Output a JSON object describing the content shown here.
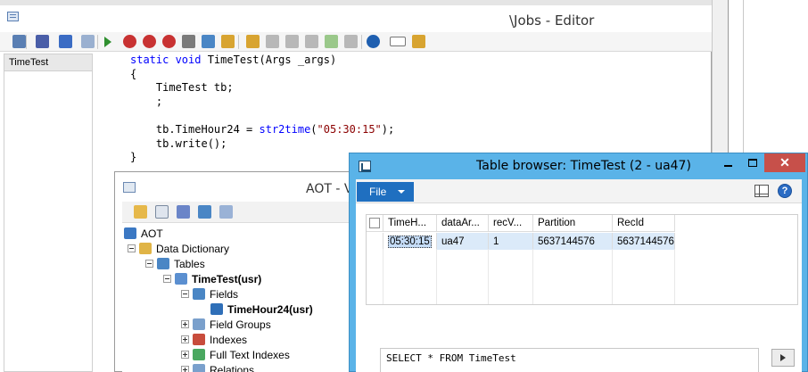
{
  "editor": {
    "title": "\\Jobs - Editor",
    "left_pane_items": [
      "TimeTest"
    ],
    "code_lines": [
      {
        "parts": [
          {
            "t": "static void ",
            "c": "kw"
          },
          {
            "t": "TimeTest(Args _args)",
            "c": ""
          }
        ]
      },
      {
        "parts": [
          {
            "t": "{",
            "c": ""
          }
        ]
      },
      {
        "parts": [
          {
            "t": "    TimeTest tb;",
            "c": ""
          }
        ]
      },
      {
        "parts": [
          {
            "t": "    ;",
            "c": ""
          }
        ]
      },
      {
        "parts": [
          {
            "t": "",
            "c": ""
          }
        ]
      },
      {
        "parts": [
          {
            "t": "    tb.TimeHour24 = ",
            "c": ""
          },
          {
            "t": "str2time",
            "c": "fn"
          },
          {
            "t": "(",
            "c": ""
          },
          {
            "t": "\"05:30:15\"",
            "c": "str"
          },
          {
            "t": ");",
            "c": ""
          }
        ]
      },
      {
        "parts": [
          {
            "t": "    tb.write();",
            "c": ""
          }
        ]
      },
      {
        "parts": [
          {
            "t": "}",
            "c": ""
          }
        ]
      }
    ],
    "toolbar_icons": [
      "new-icon",
      "save-icon",
      "undo-icon",
      "redo-icon",
      "run-icon",
      "breakpoint-icon",
      "remove-breakpoint-icon",
      "disable-breakpoints-icon",
      "compile-icon",
      "lookup-icon",
      "lookup-property-icon",
      "script-icon",
      "copy-icon",
      "paste-icon",
      "undo-alt-icon",
      "refresh-icon",
      "forward-icon",
      "help-icon",
      "line-numbers-icon",
      "wand-icon"
    ]
  },
  "aot": {
    "title": "AOT - V",
    "tree": [
      {
        "label": "AOT",
        "indent": 0,
        "expander": "none",
        "icon": "aot-icon",
        "bold": false,
        "color": "#3b78c3"
      },
      {
        "label": "Data Dictionary",
        "indent": 1,
        "expander": "minus",
        "icon": "database-icon",
        "bold": false,
        "color": "#e0b446"
      },
      {
        "label": "Tables",
        "indent": 2,
        "expander": "minus",
        "icon": "tables-icon",
        "bold": false,
        "color": "#4a86c5"
      },
      {
        "label": "TimeTest(usr)",
        "indent": 3,
        "expander": "minus",
        "icon": "table-icon",
        "bold": true,
        "color": "#5b8fd0"
      },
      {
        "label": "Fields",
        "indent": 4,
        "expander": "minus",
        "icon": "fields-icon",
        "bold": false,
        "color": "#4a86c5"
      },
      {
        "label": "TimeHour24(usr)",
        "indent": 5,
        "expander": "none",
        "icon": "field-icon",
        "bold": true,
        "color": "#2f6fb8"
      },
      {
        "label": "Field Groups",
        "indent": 4,
        "expander": "plus",
        "icon": "field-groups-icon",
        "bold": false,
        "color": "#7aa0cc"
      },
      {
        "label": "Indexes",
        "indent": 4,
        "expander": "plus",
        "icon": "indexes-icon",
        "bold": false,
        "color": "#c84c3c"
      },
      {
        "label": "Full Text Indexes",
        "indent": 4,
        "expander": "plus",
        "icon": "full-text-indexes-icon",
        "bold": false,
        "color": "#4aa860"
      },
      {
        "label": "Relations",
        "indent": 4,
        "expander": "plus",
        "icon": "relations-icon",
        "bold": false,
        "color": "#7aa0cc"
      }
    ]
  },
  "table_browser": {
    "title": "Table browser: TimeTest (2 - ua47)",
    "file_label": "File",
    "help_glyph": "?",
    "close_glyph": "✕",
    "columns": [
      "TimeH...",
      "dataAr...",
      "recV...",
      "Partition",
      "RecId"
    ],
    "rows": [
      [
        "05:30:15",
        "ua47",
        "1",
        "5637144576",
        "5637144576"
      ]
    ],
    "sql": "SELECT * FROM TimeTest"
  }
}
